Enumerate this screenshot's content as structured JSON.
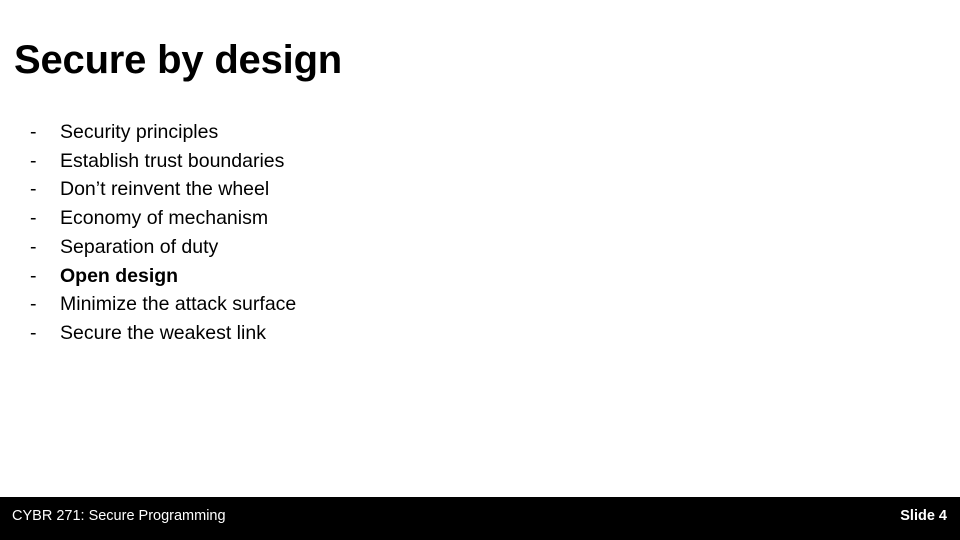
{
  "slide": {
    "title": "Secure by design",
    "bullets": [
      {
        "marker": "-",
        "text": "Security principles",
        "bold": false
      },
      {
        "marker": "-",
        "text": "Establish trust boundaries",
        "bold": false
      },
      {
        "marker": "-",
        "text": "Don’t reinvent the wheel",
        "bold": false
      },
      {
        "marker": "-",
        "text": "Economy of mechanism",
        "bold": false
      },
      {
        "marker": "-",
        "text": "Separation of duty",
        "bold": false
      },
      {
        "marker": "-",
        "text": "Open design",
        "bold": true
      },
      {
        "marker": "-",
        "text": "Minimize the attack surface",
        "bold": false
      },
      {
        "marker": "-",
        "text": "Secure the weakest link",
        "bold": false
      }
    ],
    "footer": {
      "course": "CYBR 271: Secure Programming",
      "slide_number": "Slide 4",
      "background_color": "#000000",
      "text_color": "#ffffff"
    }
  }
}
